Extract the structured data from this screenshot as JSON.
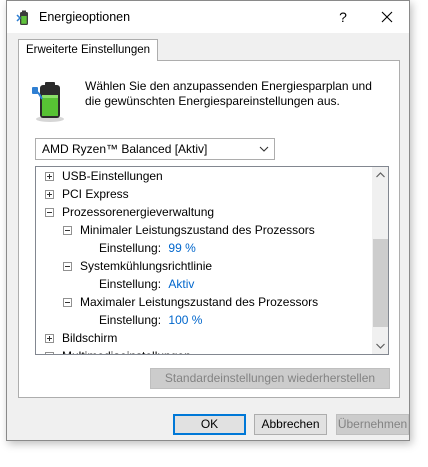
{
  "window": {
    "title": "Energieoptionen",
    "help_label": "?",
    "close_icon": "close-icon"
  },
  "tabs": [
    {
      "label": "Erweiterte Einstellungen",
      "active": true
    }
  ],
  "intro": {
    "text": "Wählen Sie den anzupassenden Energiesparplan und die gewünschten Energiespareinstellungen aus.",
    "icon": "battery-plug-icon"
  },
  "plan_select": {
    "value": "AMD Ryzen™ Balanced [Aktiv]"
  },
  "tree": {
    "usb": "USB-Einstellungen",
    "pci": "PCI Express",
    "processor": "Prozessorenergieverwaltung",
    "min_state": "Minimaler Leistungszustand des Prozessors",
    "min_state_setting_label": "Einstellung:",
    "min_state_setting_value": "99 %",
    "cooling": "Systemkühlungsrichtlinie",
    "cooling_setting_label": "Einstellung:",
    "cooling_setting_value": "Aktiv",
    "max_state": "Maximaler Leistungszustand des Prozessors",
    "max_state_setting_label": "Einstellung:",
    "max_state_setting_value": "100 %",
    "display": "Bildschirm",
    "multimedia": "Multimediaeinstellungen"
  },
  "buttons": {
    "restore": "Standardeinstellungen wiederherstellen",
    "ok": "OK",
    "cancel": "Abbrechen",
    "apply": "Übernehmen"
  },
  "colors": {
    "value_link": "#0066cc",
    "ok_border": "#0078d7",
    "disabled_text": "#838383"
  }
}
